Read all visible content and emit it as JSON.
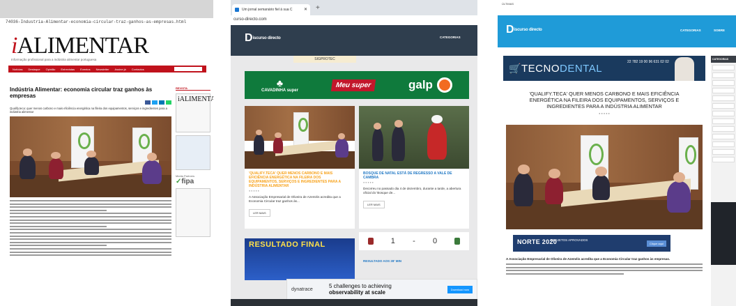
{
  "panel1": {
    "url": "74036-Industria-Alimentar-economia-circular-traz-ganhos-as-empresas.html",
    "logo_i": "i",
    "logo_rest": "ALIMENTAR",
    "tagline": "Informação profissional para a indústria alimentar portuguesa",
    "nav": [
      "Notícias",
      "Destaque",
      "Opinião",
      "Entrevistas",
      "Eventos",
      "Newsletter",
      "Assine já",
      "Contactos"
    ],
    "article": {
      "title": "Indústria Alimentar: economia circular traz ganhos às empresas",
      "lead": "Qualify.teca: quer menos carbono e mais eficiência energética na fileira dos equipamentos, serviços e ingredientes para a indústria alimentar"
    },
    "sidebar": {
      "heading": "REVISTA",
      "mini_logo": "iALIMENTA",
      "media_partners": "Media Partners",
      "fipa": "fipa"
    },
    "colors": {
      "brand": "#c0121c"
    }
  },
  "panel2": {
    "tab_title": "Um jornal semanário fiel à sua C",
    "url": "curso-directo.com",
    "logo_letter": "D",
    "logo_word": "iscurso directo",
    "categorias": "CATEGORIAS",
    "sponsor": "SIGPROTEC",
    "ads": {
      "cav": "CAVADINHA super",
      "meu": "Meu super",
      "galp": "galp"
    },
    "cards": [
      {
        "title": "'QUALIFY.TECA' QUER MENOS CARBONO E MAIS EFICIÊNCIA ENERGÉTICA NA FILEIRA DOS EQUIPAMENTOS, SERVIÇOS E INGREDIENTES PARA A INDÚSTRIA ALIMENTAR",
        "excerpt": "A Associação Empresarial de Oliveira de Azeméis acredita que a Economia Circular traz ganhos às...",
        "button": "LER MAIS"
      },
      {
        "title": "BOSQUE DE NATAL ESTÁ DE REGRESSO A VALE DE CAMBRA",
        "excerpt": "Decorreu no passado dia 4 de dezembro, durante a tarde, a abertura oficial do 'Bosque de...",
        "button": "LER MAIS"
      }
    ],
    "score": {
      "home": "1",
      "sep": "-",
      "away": "0"
    },
    "resultado": "RESULTADO FINAL",
    "resultado2": "RESULTADO AOS 28' MIN",
    "dynatrace": {
      "brand": "dynatrace",
      "line1": "5 challenges to achieving",
      "line2": "observability at scale",
      "button": "Download now"
    },
    "colors": {
      "header": "#2f3e4e",
      "accent": "#f7a21b"
    }
  },
  "panel3": {
    "topbar": "ÚLTIMAS",
    "logo_letter": "D",
    "logo_word": "iscurso directo",
    "categorias": "CATEGORIAS",
    "sobre": "SOBRE",
    "tecno_main": "TECNO",
    "tecno_accent": "DENTAL",
    "tecno_phone": "22 782 19 00\n96 631 02 02",
    "title": "'QUALIFY.TECA' QUER MENOS CARBONO E MAIS EFICIÊNCIA ENERGÉTICA NA FILEIRA DOS EQUIPAMENTOS, SERVIÇOS E INGREDIENTES PARA A INDÚSTRIA ALIMENTAR",
    "norte": "NORTE 2020",
    "norte_sub": "PROJETOS APROVADOS",
    "norte_btn": "Clique aqui",
    "lead": "A Associação Empresarial de Oliveira de Azeméis acredita que a Economia Circular traz ganhos às empresas.",
    "side_head": "CATEGORIAS",
    "colors": {
      "header": "#1f9bd8"
    }
  }
}
